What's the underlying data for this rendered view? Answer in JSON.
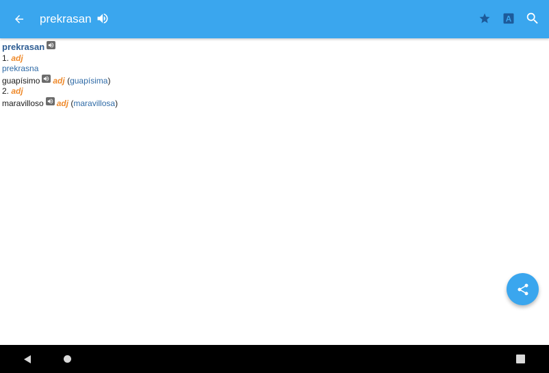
{
  "toolbar": {
    "title": "prekrasan",
    "icons": [
      "back-arrow-icon",
      "speaker-icon",
      "star-icon",
      "font-size-icon",
      "search-icon"
    ],
    "font_icon_letter": "A"
  },
  "entry": {
    "headword": "prekrasan",
    "senses": [
      {
        "number": "1.",
        "pos": "adj",
        "variant": "prekrasna",
        "translation": "guapísimo",
        "translation_pos": "adj",
        "feminine_open": "(",
        "feminine": "guapísima",
        "feminine_close": ")"
      },
      {
        "number": "2.",
        "pos": "adj",
        "translation": "maravilloso",
        "translation_pos": "adj",
        "feminine_open": "(",
        "feminine": "maravillosa",
        "feminine_close": ")"
      }
    ]
  },
  "fab": {
    "icon": "share-icon"
  },
  "navbar": {
    "icons": [
      "nav-back-icon",
      "nav-home-icon",
      "nav-recent-icon"
    ]
  },
  "colors": {
    "primary": "#3aa6ee",
    "headword": "#2e5d93",
    "pos": "#ef8a2b",
    "link": "#2e6aa6",
    "navbar": "#000000"
  }
}
